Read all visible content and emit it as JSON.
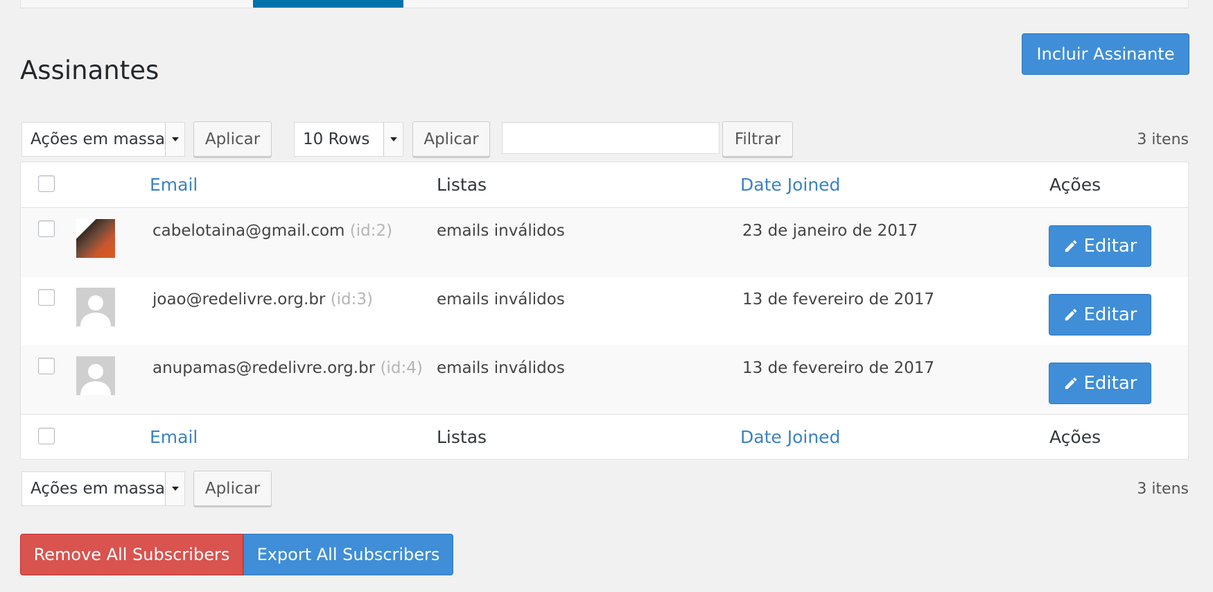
{
  "page": {
    "title": "Assinantes"
  },
  "header": {
    "add_button": "Incluir Assinante"
  },
  "top_toolbar": {
    "bulk_select": "Ações em massa",
    "bulk_apply": "Aplicar",
    "rows_select": "10 Rows",
    "rows_apply": "Aplicar",
    "filter_value": "",
    "filter_button": "Filtrar",
    "count": "3 itens"
  },
  "table": {
    "columns": {
      "email": "Email",
      "lists": "Listas",
      "date": "Date Joined",
      "actions": "Ações"
    },
    "rows": [
      {
        "email": "cabelotaina@gmail.com",
        "id": "(id:2)",
        "lists": "emails inválidos",
        "date": "23 de janeiro de 2017",
        "avatar": "photo",
        "action": "Editar"
      },
      {
        "email": "joao@redelivre.org.br",
        "id": "(id:3)",
        "lists": "emails inválidos",
        "date": "13 de fevereiro de 2017",
        "avatar": "default",
        "action": "Editar"
      },
      {
        "email": "anupamas@redelivre.org.br",
        "id": "(id:4)",
        "lists": "emails inválidos",
        "date": "13 de fevereiro de 2017",
        "avatar": "default",
        "action": "Editar"
      }
    ]
  },
  "bottom_toolbar": {
    "bulk_select": "Ações em massa",
    "bulk_apply": "Aplicar",
    "count": "3 itens"
  },
  "footer_actions": {
    "remove_all": "Remove All Subscribers",
    "export_all": "Export All Subscribers"
  },
  "colors": {
    "primary": "#3f8ed7",
    "danger": "#d9534f",
    "link": "#3b82c4",
    "active_tab": "#0073aa"
  },
  "icons": {
    "edit": "pencil-icon",
    "dropdown": "caret-down-icon",
    "avatar_default": "user-silhouette-icon"
  }
}
